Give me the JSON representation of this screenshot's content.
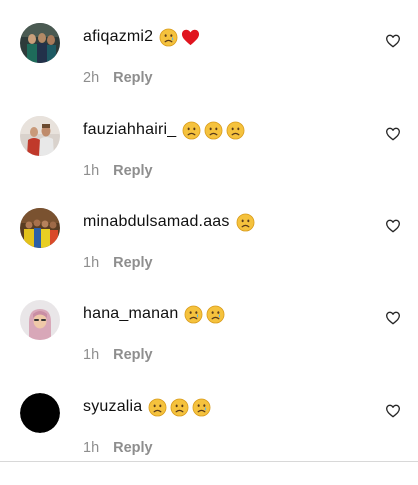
{
  "comments": [
    {
      "username": "afiqazmi2",
      "time": "2h",
      "reply_label": "Reply",
      "emojis": [
        "crying-face-icon",
        "red-heart-icon"
      ]
    },
    {
      "username": "fauziahhairi_",
      "time": "1h",
      "reply_label": "Reply",
      "emojis": [
        "sad-face-icon",
        "sad-face-icon",
        "sad-face-icon"
      ]
    },
    {
      "username": "minabdulsamad.aas",
      "time": "1h",
      "reply_label": "Reply",
      "emojis": [
        "sad-face-icon"
      ]
    },
    {
      "username": "hana_manan",
      "time": "1h",
      "reply_label": "Reply",
      "emojis": [
        "crying-face-icon",
        "crying-face-icon"
      ]
    },
    {
      "username": "syuzalia",
      "time": "1h",
      "reply_label": "Reply",
      "emojis": [
        "sad-face-icon",
        "sad-face-icon",
        "crying-face-icon"
      ]
    }
  ],
  "colors": {
    "meta_text": "#8e8e8e",
    "emoji_yellow": "#f5c23d",
    "heart_red": "#e0151f",
    "divider": "#d8d8d8"
  },
  "icons": {
    "like": "heart-outline-icon"
  }
}
